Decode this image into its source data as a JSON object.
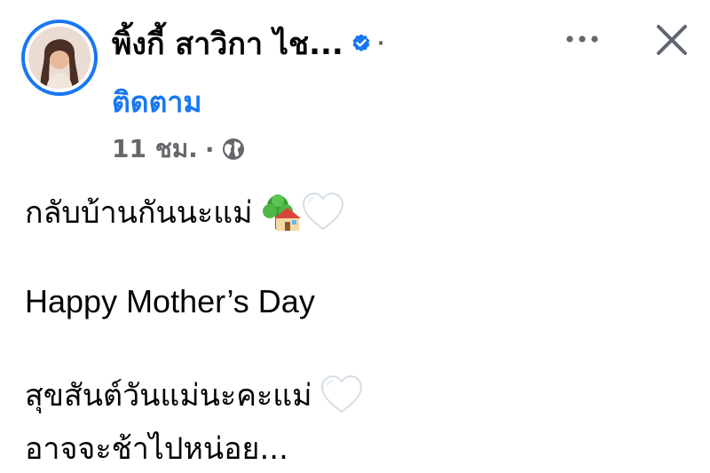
{
  "header": {
    "name": "พิ้งกี้ สาวิกา ไช...",
    "separator": "·",
    "follow_label": "ติดตาม",
    "time": "11 ชม.",
    "meta_separator": "·"
  },
  "icons": {
    "more": "more-horizontal-icon",
    "close": "close-icon",
    "verified": "verified-badge-icon",
    "globe": "globe-icon",
    "tree": "tree-emoji",
    "house": "house-emoji",
    "heart": "white-heart-emoji"
  },
  "colors": {
    "accent": "#1877f2",
    "muted": "#65676b",
    "text": "#050505"
  },
  "post": {
    "line1": "กลับบ้านกันนะแม่",
    "line2": "Happy Mother’s Day",
    "line3": "สุขสันต์วันแม่นะคะแม่",
    "line4": "อาจจะช้าไปหน่อย..."
  }
}
